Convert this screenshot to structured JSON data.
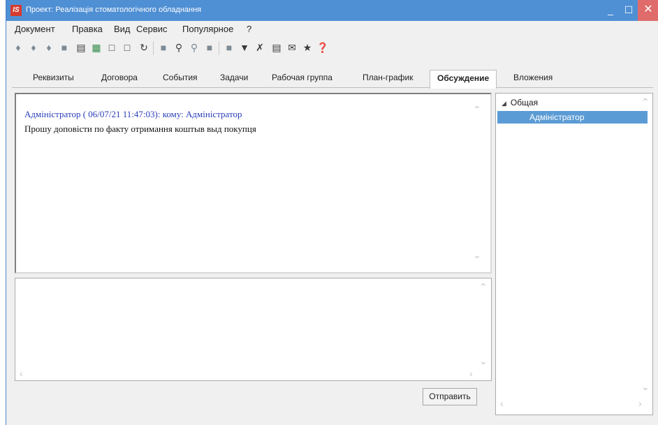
{
  "window": {
    "title": "Проект: Реалізація стоматологічного обладнання",
    "app_icon_text": "IS",
    "controls": {
      "minimize": "_",
      "maximize": "☐",
      "close": "✕"
    }
  },
  "menu": [
    "Документ",
    "Правка",
    "Вид",
    "Сервис",
    "Популярное",
    "?"
  ],
  "toolbar": {
    "icons": [
      "add-icon",
      "edit-icon",
      "copy-icon",
      "delete-icon",
      "print-icon",
      "excel-icon",
      "new-doc-icon",
      "new-doc-2-icon",
      "refresh-icon",
      "stop-icon",
      "search-icon",
      "search-next-icon",
      "filter-block-icon",
      "grid-icon",
      "filter-icon",
      "clear-filter-icon",
      "form-icon",
      "mail-icon",
      "star-icon",
      "help-icon"
    ]
  },
  "tabs": [
    {
      "label": "Реквизиты",
      "active": false
    },
    {
      "label": "Договора",
      "active": false
    },
    {
      "label": "События",
      "active": false
    },
    {
      "label": "Задачи",
      "active": false
    },
    {
      "label": "Рабочая группа",
      "active": false
    },
    {
      "label": "План-график",
      "active": false
    },
    {
      "label": "Обсуждение",
      "active": true
    },
    {
      "label": "Вложения",
      "active": false
    }
  ],
  "discussion": {
    "messages": [
      {
        "header": "Адміністратор ( 06/07/21 11:47:03): кому: Адміністратор",
        "text": "Прошу доповісти по факту отримання коштыв выд покупця"
      }
    ],
    "input_value": "",
    "send_label": "Отправить"
  },
  "recipients": {
    "group": "Общая",
    "items": [
      {
        "label": "Адміністратор",
        "selected": true
      }
    ]
  },
  "colors": {
    "titlebar": "#4f8fd4",
    "close_button": "#e06b6b",
    "message_header": "#2b3fb8",
    "selection": "#5b9bd5"
  }
}
